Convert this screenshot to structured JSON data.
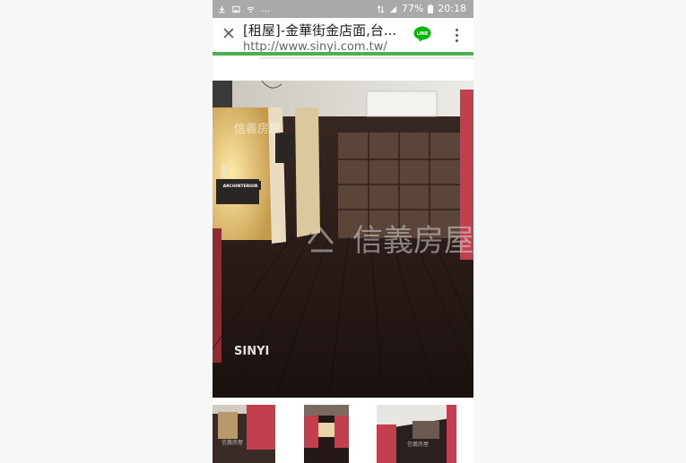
{
  "statusbar": {
    "left_text": "...",
    "battery": "77%",
    "time": "20:18"
  },
  "tab": {
    "title": "[租屋]-金華街金店面,台...",
    "url": "http://www.sinyi.com.tw/",
    "close_icon": "close-icon",
    "line_label": "LINE"
  },
  "gallery": {
    "photo_sign": "ARCHINTERIOR",
    "watermark_main": "信義房屋",
    "watermark_small": "信義房屋",
    "brand": "SINYI",
    "thumb_watermark": "信義房屋"
  },
  "colors": {
    "progress": "#4caf50",
    "line_green": "#00b900",
    "statusbar": "#a9a9a9"
  }
}
